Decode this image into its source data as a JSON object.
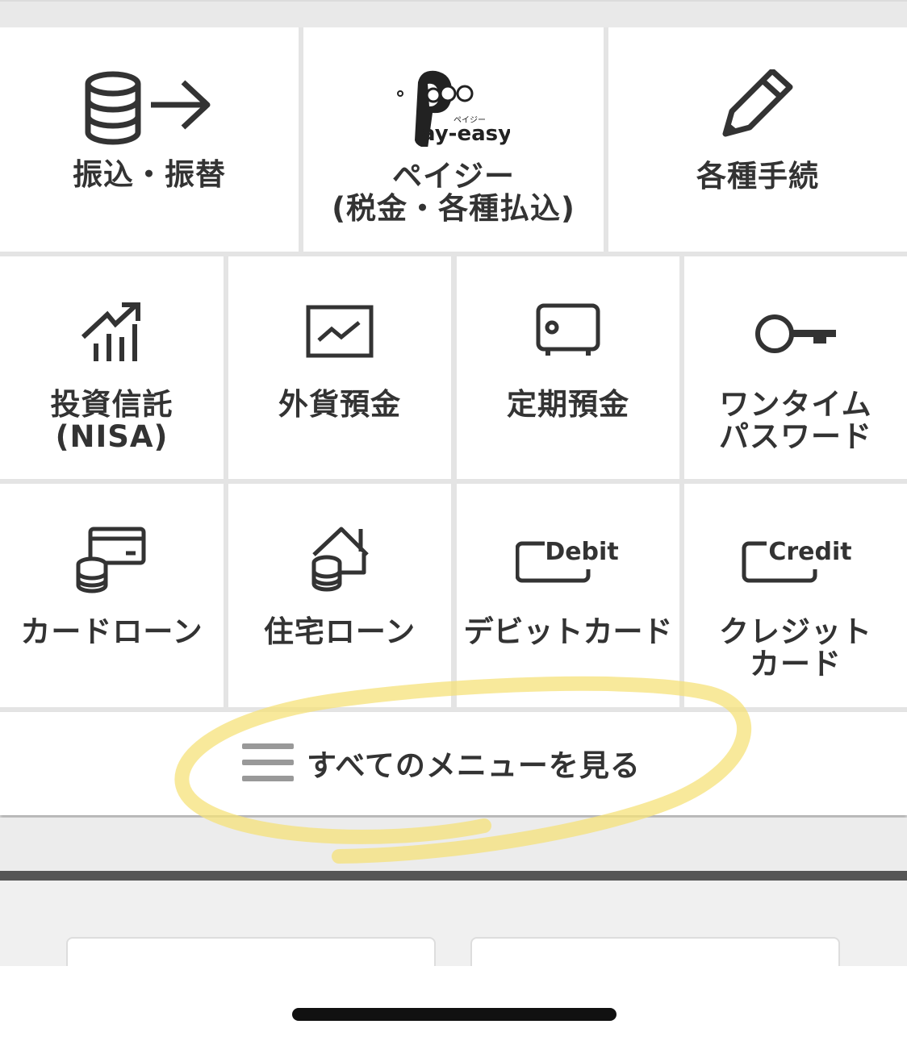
{
  "tiles_row1": [
    {
      "label_lines": [
        "振込・振替"
      ]
    },
    {
      "label_lines": [
        "ペイジー",
        "(税金・各種払込)"
      ],
      "logo_text": "ay-easy",
      "logo_small": "ペイジー"
    },
    {
      "label_lines": [
        "各種手続"
      ]
    }
  ],
  "tiles_row2": [
    {
      "label_lines": [
        "投資信託",
        "(NISA)"
      ]
    },
    {
      "label_lines": [
        "外貨預金"
      ]
    },
    {
      "label_lines": [
        "定期預金"
      ]
    },
    {
      "label_lines": [
        "ワンタイム",
        "パスワード"
      ]
    }
  ],
  "tiles_row3": [
    {
      "label_lines": [
        "カードローン"
      ]
    },
    {
      "label_lines": [
        "住宅ローン"
      ]
    },
    {
      "label_lines": [
        "デビットカード"
      ],
      "card_text": "Debit"
    },
    {
      "label_lines": [
        "クレジット",
        "カード"
      ],
      "card_text": "Credit"
    }
  ],
  "more_menu": {
    "label": "すべてのメニューを見る"
  },
  "colors": {
    "icon": "#333333",
    "menu_lines": "#999999",
    "highlight": "#f5e27a"
  }
}
